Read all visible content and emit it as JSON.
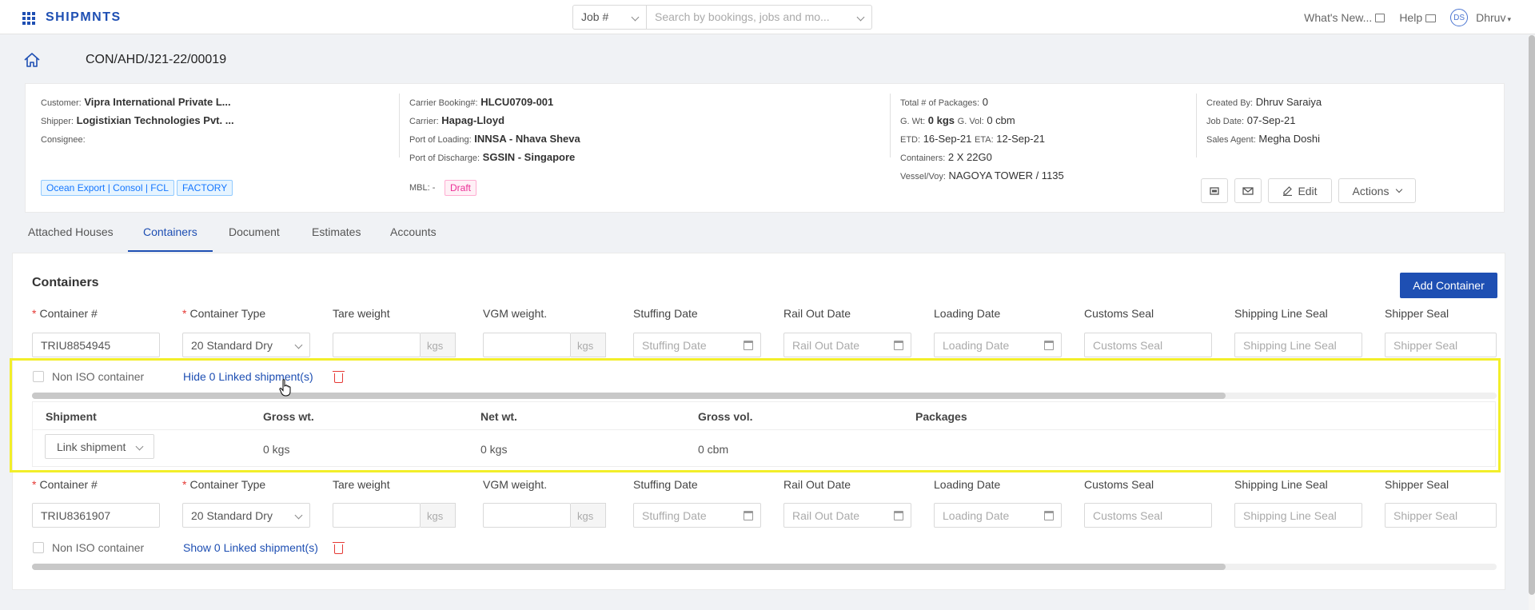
{
  "brand": "SHIPMNTS",
  "search": {
    "filter": "Job #",
    "placeholder": "Search by bookings, jobs and mo..."
  },
  "topnav": {
    "whats_new": "What's New...",
    "help": "Help",
    "avatar_initials": "DS",
    "user": "Dhruv"
  },
  "job_id": "CON/AHD/J21-22/00019",
  "summary": {
    "customer_label": "Customer:",
    "customer": "Vipra International Private L...",
    "shipper_label": "Shipper:",
    "shipper": "Logistixian Technologies Pvt. ...",
    "consignee_label": "Consignee:",
    "carrier_booking_label": "Carrier Booking#:",
    "carrier_booking": "HLCU0709-001",
    "carrier_label": "Carrier:",
    "carrier": "Hapag-Lloyd",
    "pol_label": "Port of Loading:",
    "pol": "INNSA - Nhava Sheva",
    "pod_label": "Port of Discharge:",
    "pod": "SGSIN - Singapore",
    "packages_label": "Total # of Packages:",
    "packages": "0",
    "gwt_label": "G. Wt:",
    "gwt": "0 kgs",
    "gvol_label": "G. Vol:",
    "gvol": "0 cbm",
    "etd_label": "ETD:",
    "etd": "16-Sep-21",
    "eta_label": "ETA:",
    "eta": "12-Sep-21",
    "containers_label": "Containers:",
    "containers": "2 X 22G0",
    "vessel_label": "Vessel/Voy:",
    "vessel": "NAGOYA TOWER / 1135",
    "created_by_label": "Created By:",
    "created_by": "Dhruv Saraiya",
    "job_date_label": "Job Date:",
    "job_date": "07-Sep-21",
    "sales_agent_label": "Sales Agent:",
    "sales_agent": "Megha Doshi",
    "tag1": "Ocean Export | Consol | FCL",
    "tag2": "FACTORY",
    "mbl_label": "MBL:",
    "mbl_value": "-",
    "status": "Draft",
    "edit_label": "Edit",
    "actions_label": "Actions"
  },
  "tabs": [
    "Attached Houses",
    "Containers",
    "Document",
    "Estimates",
    "Accounts"
  ],
  "panel": {
    "title": "Containers",
    "add_button": "Add Container",
    "headers": {
      "container_no": "Container #",
      "container_type": "Container Type",
      "tare": "Tare weight",
      "vgm": "VGM weight.",
      "stuffing": "Stuffing Date",
      "rail_out": "Rail Out Date",
      "loading": "Loading Date",
      "customs_seal": "Customs Seal",
      "shipping_line_seal": "Shipping Line Seal",
      "shipper_seal": "Shipper Seal"
    },
    "unit": "kgs",
    "placeholders": {
      "stuffing": "Stuffing Date",
      "rail_out": "Rail Out Date",
      "loading": "Loading Date",
      "customs_seal": "Customs Seal",
      "shipping_line_seal": "Shipping Line Seal",
      "shipper_seal": "Shipper Seal"
    },
    "non_iso_label": "Non ISO container",
    "containers": [
      {
        "number": "TRIU8854945",
        "type": "20 Standard Dry",
        "toggle": "Hide 0 Linked shipment(s)"
      },
      {
        "number": "TRIU8361907",
        "type": "20 Standard Dry",
        "toggle": "Show 0 Linked shipment(s)"
      }
    ],
    "linked": {
      "headers": [
        "Shipment",
        "Gross wt.",
        "Net wt.",
        "Gross vol.",
        "Packages"
      ],
      "link_button": "Link shipment",
      "gross_wt": "0 kgs",
      "net_wt": "0 kgs",
      "gross_vol": "0 cbm"
    }
  }
}
